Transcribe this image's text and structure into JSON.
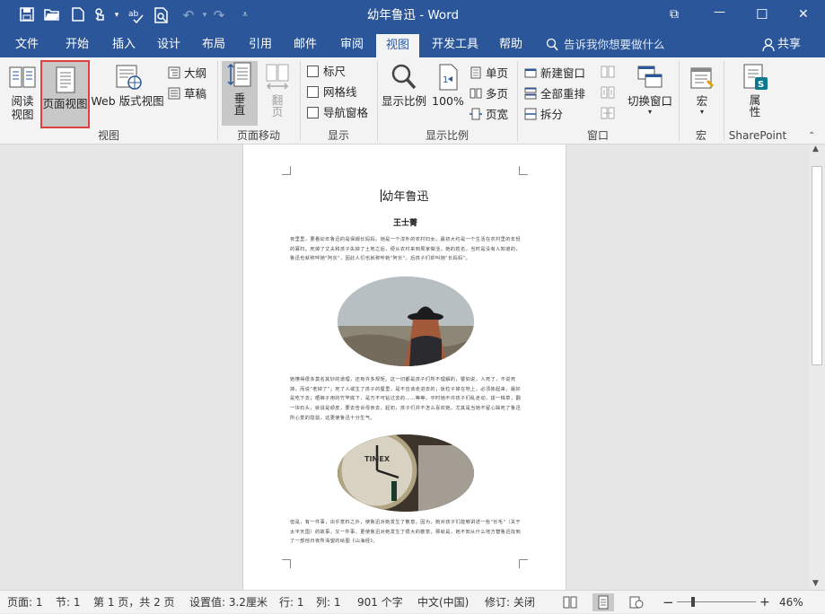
{
  "window": {
    "title": "幼年鲁迅 - Word",
    "controls": {
      "restore": "⧉",
      "minimize": "—",
      "maximize": "☐",
      "close": "✕"
    }
  },
  "quick_access": {
    "save_icon": "save-icon",
    "open_icon": "open-icon",
    "new_icon": "new-icon",
    "touch_icon": "touch-mode-icon",
    "spelling_icon": "spelling-icon",
    "preview_icon": "print-preview-icon",
    "undo_icon": "undo-icon",
    "redo_icon": "redo-icon",
    "customize_icon": "customize-icon"
  },
  "tabs": [
    "文件",
    "开始",
    "插入",
    "设计",
    "布局",
    "引用",
    "邮件",
    "审阅",
    "视图",
    "开发工具",
    "帮助"
  ],
  "active_tab": "视图",
  "tell_me": "告诉我你想要做什么",
  "share": "共享",
  "ribbon": {
    "views": {
      "read": "阅读\n视图",
      "print_layout": "页面视图",
      "web_layout": "Web 版式视图",
      "outline": "大纲",
      "draft": "草稿",
      "group": "视图"
    },
    "page_movement": {
      "vertical": "垂\n直",
      "side": "翻\n页",
      "group": "页面移动"
    },
    "show": {
      "ruler": "标尺",
      "gridlines": "网格线",
      "nav_pane": "导航窗格",
      "group": "显示"
    },
    "zoom": {
      "zoom": "显示比例",
      "hundred": "100%",
      "one_page": "单页",
      "multiple": "多页",
      "page_width": "页宽",
      "group": "显示比例"
    },
    "window": {
      "new_window": "新建窗口",
      "arrange_all": "全部重排",
      "split": "拆分",
      "switch_windows": "切换窗口",
      "group": "窗口"
    },
    "macros": {
      "macros": "宏",
      "group": "宏"
    },
    "sharepoint": {
      "properties": "属\n性",
      "group": "SharePoint"
    }
  },
  "document": {
    "title": "幼年鲁迅",
    "author": "王士菁",
    "para1": "夜里里，要看幼年鲁迅的是保姆长妈妈。她是一个淳朴的农村妇女。最初大约是一个生活在农村里的年轻的寡妇。死掉了丈夫和孩子失掉了土地之后，便从农村来到周家做活。她的姓名，当时是没有人知道的，鲁迅也就称呼她\"阿长\"，因此人们也就称呼她\"阿长\"。后孩子们却叫她\"长妈妈\"。",
    "para2": "她懂得很多莫名其妙的道理，还有许多规矩。这一切都是孩子们所不理解的，譬如说，人死了，不说死掉，而说\"老掉了\"；死了人或生了孩子的屋里，是不应该走进去的；饭粒子掉在地上，必须拣起来，最好是吃下去；晒裤子用的竹竿底下，是万不可钻过去的……等等。平时她不许孩子们乱走动，拔一株草，翻一块石头，就说是顽皮，要去告诉母亲去。起初，孩子们并不怎么喜欢她，尤其是当她不留心踩死了鲁迅所心爱的隐鼠，这更使鲁迅十分生气。",
    "para3": "但是，有一件事，出乎意料之外，使鲁迅对她发生了敬意。因为，她对孩子们能够讲述一些\"长毛\"（关于太平天国）的故事，又一件事，更使鲁迅对她发生了很大的敬意，那就是，她不知从什么地方替鲁迅找到了一部他日夜所渴望的绘图《山海经》。"
  },
  "status": {
    "page": "页面: 1",
    "section": "节: 1",
    "page_of": "第 1 页，共 2 页",
    "at": "设置值: 3.2厘米",
    "line": "行: 1",
    "column": "列: 1",
    "words": "901 个字",
    "language": "中文(中国)",
    "track": "修订: 关闭",
    "zoom_minus": "−",
    "zoom_plus": "+",
    "zoom_level": "46%",
    "zoom_fraction": 0.46
  },
  "colors": {
    "brand": "#2b579a",
    "highlight_border": "#e04040",
    "active_button": "#c8c8c8"
  }
}
